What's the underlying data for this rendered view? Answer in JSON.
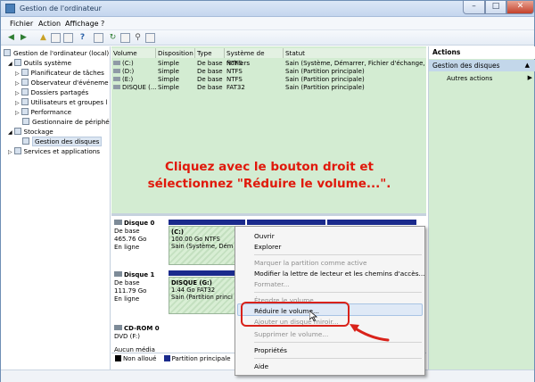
{
  "window": {
    "title": "Gestion de l'ordinateur"
  },
  "menu": [
    "Fichier",
    "Action",
    "Affichage",
    "?"
  ],
  "tree": {
    "root": "Gestion de l'ordinateur (local)",
    "outils": "Outils système",
    "items": [
      "Planificateur de tâches",
      "Observateur d'événeme",
      "Dossiers partagés",
      "Utilisateurs et groupes l",
      "Performance",
      "Gestionnaire de périphé"
    ],
    "stockage": "Stockage",
    "gestion_disques": "Gestion des disques",
    "services": "Services et applications"
  },
  "columns": [
    "Volume",
    "Disposition",
    "Type",
    "Système de fichiers",
    "Statut"
  ],
  "volumes": [
    {
      "volume": "(C:)",
      "disposition": "Simple",
      "type": "De base",
      "fs": "NTFS",
      "statut": "Sain (Système, Démarrer, Fichier d'échange, Actif,"
    },
    {
      "volume": "(D:)",
      "disposition": "Simple",
      "type": "De base",
      "fs": "NTFS",
      "statut": "Sain (Partition principale)"
    },
    {
      "volume": "(E:)",
      "disposition": "Simple",
      "type": "De base",
      "fs": "NTFS",
      "statut": "Sain (Partition principale)"
    },
    {
      "volume": "DISQUE (...",
      "disposition": "Simple",
      "type": "De base",
      "fs": "FAT32",
      "statut": "Sain (Partition principale)"
    }
  ],
  "instruction": {
    "line1": "Cliquez avec le bouton droit et",
    "line2": "sélectionnez \"Réduire le volume...\"."
  },
  "disks": [
    {
      "name": "Disque 0",
      "type": "De base",
      "size": "465.76 Go",
      "state": "En ligne",
      "part_name": "(C:)",
      "part_size": "100.00 Go NTFS",
      "part_status": "Sain (Système, Démarr"
    },
    {
      "name": "Disque 1",
      "type": "De base",
      "size": "111.79 Go",
      "state": "En ligne",
      "part_name": "DISQUE  (G:)",
      "part_size": "1.44 Go FAT32",
      "part_status": "Sain (Partition princi"
    },
    {
      "name": "CD-ROM 0",
      "type": "DVD (F:)",
      "size": "",
      "state": "Aucun média",
      "part_name": "",
      "part_size": "",
      "part_status": ""
    }
  ],
  "legend": {
    "unallocated": "Non alloué",
    "primary": "Partition principale"
  },
  "actions": {
    "header": "Actions",
    "section": "Gestion des disques",
    "item": "Autres actions"
  },
  "context_menu": {
    "ouvrir": "Ouvrir",
    "explorer": "Explorer",
    "marquer": "Marquer la partition comme active",
    "modifier": "Modifier la lettre de lecteur et les chemins d'accès...",
    "formater": "Formater...",
    "etendre": "Étendre le volume...",
    "reduire": "Réduire le volume...",
    "ajouter": "Ajouter un disque miroir...",
    "supprimer": "Supprimer le volume...",
    "proprietes": "Propriétés",
    "aide": "Aide"
  },
  "colors": {
    "accent_red": "#e0190b",
    "list_bg": "#d3ecd2",
    "primary_partition": "#1a2a8c"
  }
}
